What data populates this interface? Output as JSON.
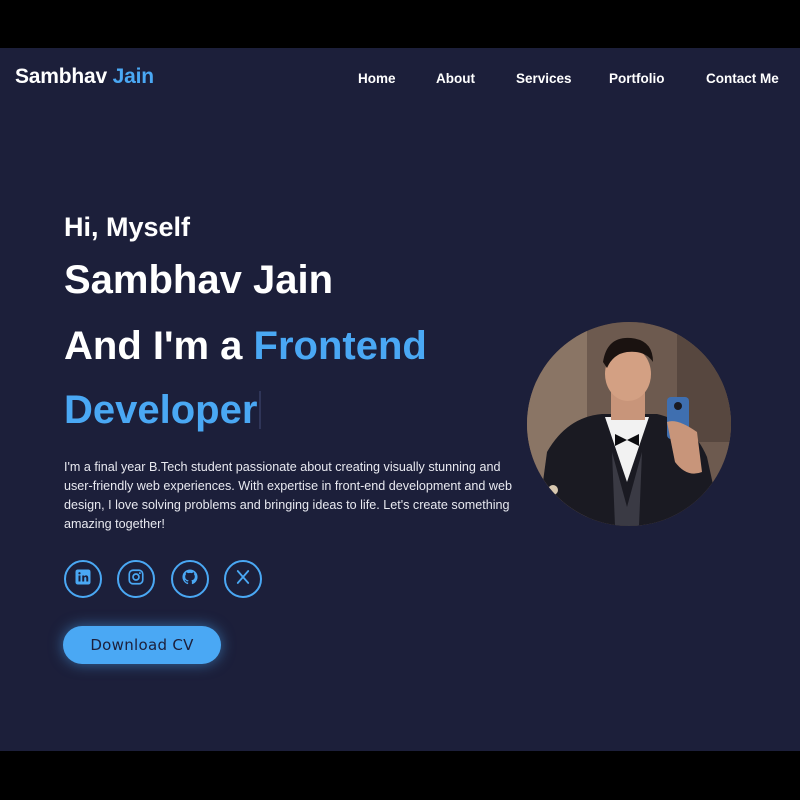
{
  "brand": {
    "first": "Sambhav",
    "last": "Jain"
  },
  "nav": {
    "items": [
      "Home",
      "About",
      "Services",
      "Portfolio",
      "Contact Me"
    ]
  },
  "hero": {
    "greeting": "Hi, Myself",
    "name": "Sambhav Jain",
    "role_prefix": "And I'm a",
    "role_highlight": "Frontend Developer",
    "bio": "I'm a final year B.Tech student passionate about creating visually stunning and user-friendly web experiences. With expertise in front-end development and web design, I love solving problems and bringing ideas to life. Let's create something amazing together!",
    "cta": "Download CV"
  },
  "socials": [
    {
      "icon": "linkedin-icon"
    },
    {
      "icon": "instagram-icon"
    },
    {
      "icon": "github-icon"
    },
    {
      "icon": "x-twitter-icon"
    }
  ],
  "colors": {
    "background": "#1c1f3a",
    "accent": "#4aa8f4",
    "text": "#ffffff"
  }
}
